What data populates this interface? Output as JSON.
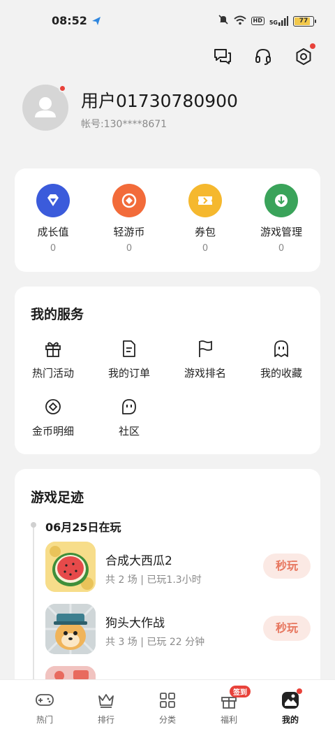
{
  "status_bar": {
    "time": "08:52",
    "battery": "77",
    "network_label": "5G",
    "hd_label": "HD"
  },
  "profile": {
    "username": "用户01730780900",
    "account": "帐号:130****8671"
  },
  "assets": [
    {
      "label": "成长值",
      "value": "0",
      "color": "#3b5bdb",
      "icon": "diamond-icon"
    },
    {
      "label": "轻游币",
      "value": "0",
      "color": "#f26b3a",
      "icon": "coin-icon"
    },
    {
      "label": "券包",
      "value": "0",
      "color": "#f5b82e",
      "icon": "ticket-icon"
    },
    {
      "label": "游戏管理",
      "value": "0",
      "color": "#3aa35a",
      "icon": "download-icon"
    }
  ],
  "services": {
    "title": "我的服务",
    "items": [
      {
        "label": "热门活动",
        "icon": "gift-icon"
      },
      {
        "label": "我的订单",
        "icon": "order-icon"
      },
      {
        "label": "游戏排名",
        "icon": "flag-icon"
      },
      {
        "label": "我的收藏",
        "icon": "ghost-icon"
      },
      {
        "label": "金币明细",
        "icon": "coin-detail-icon"
      },
      {
        "label": "社区",
        "icon": "community-icon"
      }
    ]
  },
  "footprint": {
    "title": "游戏足迹",
    "date": "06月25日在玩",
    "games": [
      {
        "name": "合成大西瓜2",
        "meta": "共 2 场 | 已玩1.3小时",
        "action": "秒玩"
      },
      {
        "name": "狗头大作战",
        "meta": "共 3 场 | 已玩 22 分钟",
        "action": "秒玩"
      }
    ]
  },
  "bottom_nav": {
    "items": [
      {
        "label": "热门",
        "icon": "gamepad-icon"
      },
      {
        "label": "排行",
        "icon": "crown-icon"
      },
      {
        "label": "分类",
        "icon": "grid-icon"
      },
      {
        "label": "福利",
        "icon": "gift-icon",
        "badge": "签到"
      },
      {
        "label": "我的",
        "icon": "profile-icon"
      }
    ],
    "active": "我的"
  },
  "colors": {
    "accent": "#e7765e",
    "badge": "#e8423a"
  }
}
